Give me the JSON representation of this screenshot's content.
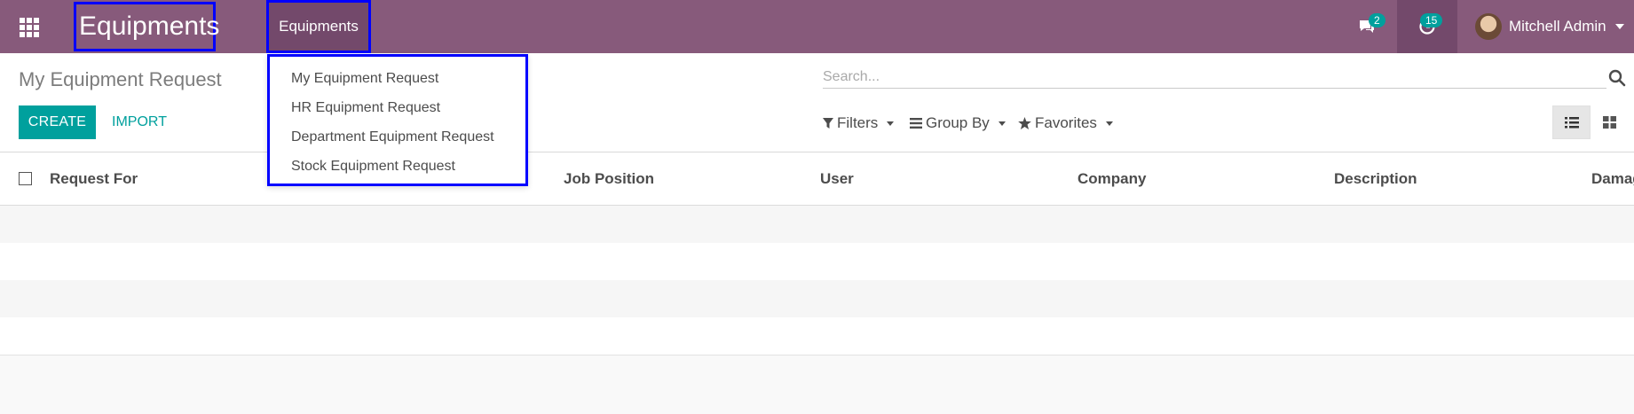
{
  "navbar": {
    "brand": "Equipments",
    "menu_section": "Equipments",
    "chat_count": "2",
    "activity_count": "15",
    "user_name": "Mitchell Admin",
    "bg_color": "#875a7b"
  },
  "dropdown": {
    "items": [
      {
        "label": "My Equipment Request"
      },
      {
        "label": "HR Equipment Request"
      },
      {
        "label": "Department Equipment Request"
      },
      {
        "label": "Stock Equipment Request"
      }
    ]
  },
  "control_panel": {
    "breadcrumb": "My Equipment Request",
    "create_label": "CREATE",
    "import_label": "IMPORT",
    "search_placeholder": "Search...",
    "filters_label": "Filters",
    "groupby_label": "Group By",
    "favorites_label": "Favorites"
  },
  "list": {
    "columns": [
      {
        "label": "Request For"
      },
      {
        "label": "Job Position"
      },
      {
        "label": "User"
      },
      {
        "label": "Company"
      },
      {
        "label": "Description"
      },
      {
        "label": "Damag"
      }
    ]
  },
  "colors": {
    "accent": "#00a09d",
    "highlight_border": "#0000ff"
  },
  "icons": [
    "apps-grid-icon",
    "chat-icon",
    "clock-icon",
    "avatar",
    "search-icon",
    "filter-icon",
    "bars-icon",
    "star-icon",
    "list-view-icon",
    "kanban-view-icon"
  ]
}
